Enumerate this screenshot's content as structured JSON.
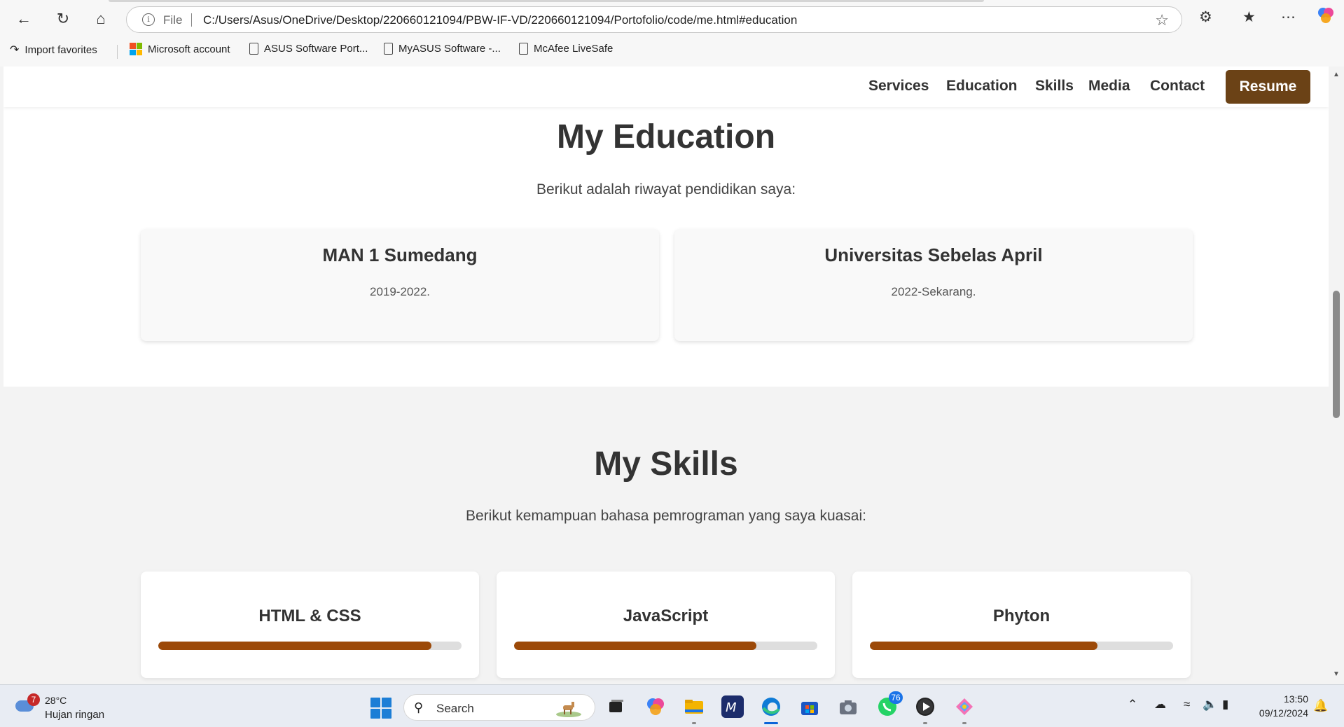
{
  "browser": {
    "address_file_label": "File",
    "url": "C:/Users/Asus/OneDrive/Desktop/220660121094/PBW-IF-VD/220660121094/Portofolio/code/me.html#education",
    "bookmarks": [
      {
        "label": "Import favorites",
        "icon": "import-icon"
      },
      {
        "label": "Microsoft account",
        "icon": "microsoft-logo-icon"
      },
      {
        "label": "ASUS Software Port...",
        "icon": "page-icon"
      },
      {
        "label": "MyASUS Software -...",
        "icon": "page-icon"
      },
      {
        "label": "McAfee LiveSafe",
        "icon": "page-icon"
      }
    ]
  },
  "nav": {
    "links": [
      "Services",
      "Education",
      "Skills",
      "Media",
      "Contact"
    ],
    "resume_label": "Resume",
    "resume_color": "#6b4216"
  },
  "education": {
    "title": "My Education",
    "subtitle": "Berikut adalah riwayat pendidikan saya:",
    "items": [
      {
        "name": "MAN 1 Sumedang",
        "years": "2019-2022."
      },
      {
        "name": "Universitas Sebelas April",
        "years": "2022-Sekarang."
      }
    ]
  },
  "skills": {
    "title": "My Skills",
    "subtitle": "Berikut kemampuan bahasa pemrograman yang saya kuasai:",
    "bar_color": "#9c4908",
    "items": [
      {
        "name": "HTML & CSS",
        "level": 0.9
      },
      {
        "name": "JavaScript",
        "level": 0.8
      },
      {
        "name": "Phyton",
        "level": 0.75
      }
    ]
  },
  "taskbar": {
    "weather_badge": "7",
    "temperature": "28°C",
    "condition": "Hujan ringan",
    "search_label": "Search",
    "whatsapp_badge": "76",
    "time": "13:50",
    "date": "09/12/2024"
  }
}
